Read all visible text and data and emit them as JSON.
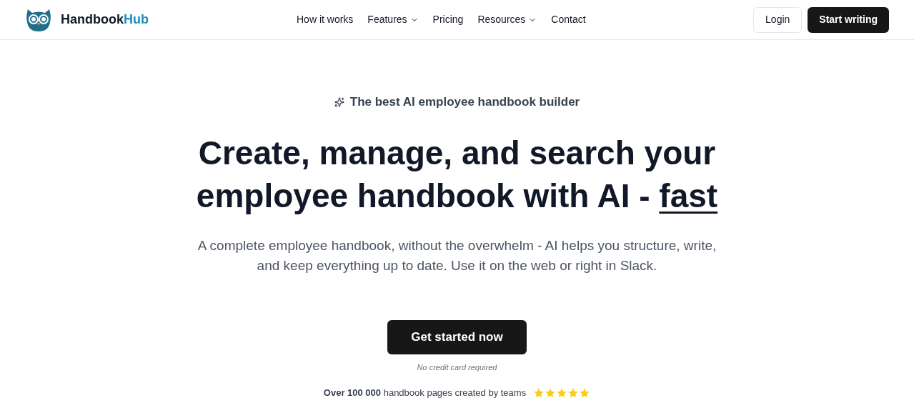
{
  "brand": {
    "name_main": "Handbook",
    "name_accent": "Hub"
  },
  "nav": [
    {
      "label": "How it works",
      "has_dropdown": false
    },
    {
      "label": "Features",
      "has_dropdown": true
    },
    {
      "label": "Pricing",
      "has_dropdown": false
    },
    {
      "label": "Resources",
      "has_dropdown": true
    },
    {
      "label": "Contact",
      "has_dropdown": false
    }
  ],
  "header_buttons": [
    {
      "label": "Login",
      "kind": "secondary"
    },
    {
      "label": "Start writing",
      "kind": "primary"
    }
  ],
  "hero": {
    "eyebrow": "The best AI employee handbook builder",
    "headline": "Create, manage, and search your employee handbook with AI -",
    "headline_emphasis": "fast",
    "subtitle": "A complete employee handbook, without the overwhelm - AI helps you structure, write, and keep everything up to date. Use it on the web or right in Slack.",
    "cta": "Get started now",
    "cta_note": "No credit card required",
    "social_proof": "**Over 100 000** handbook pages created by teams",
    "stars": 5
  }
}
